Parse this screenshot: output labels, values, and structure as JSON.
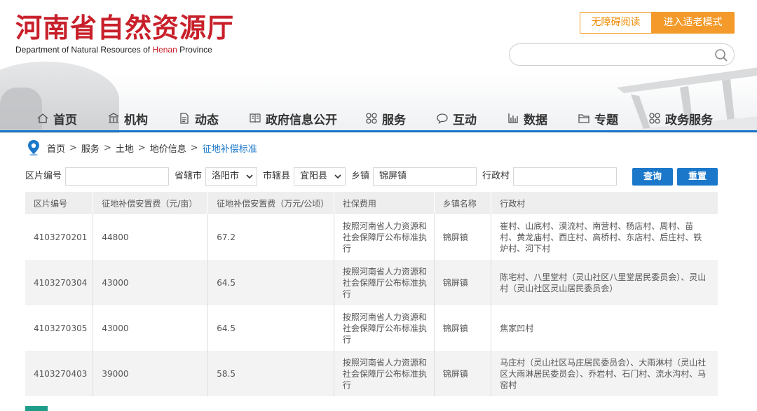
{
  "header": {
    "logo_cn": "河南省自然资源厅",
    "logo_en_prefix": "Department of Natural Resources of ",
    "logo_en_henan": "Henan",
    "logo_en_suffix": " Province",
    "accessibility_label": "无障碍阅读",
    "elder_mode_label": "进入适老模式",
    "search_placeholder": ""
  },
  "nav": {
    "items": [
      {
        "label": "首页",
        "icon": "home-icon"
      },
      {
        "label": "机构",
        "icon": "building-icon"
      },
      {
        "label": "动态",
        "icon": "document-icon"
      },
      {
        "label": "政府信息公开",
        "icon": "book-icon"
      },
      {
        "label": "服务",
        "icon": "grid-icon"
      },
      {
        "label": "互动",
        "icon": "chat-icon"
      },
      {
        "label": "数据",
        "icon": "bar-chart-icon"
      },
      {
        "label": "专题",
        "icon": "folder-icon"
      },
      {
        "label": "政务服务",
        "icon": "grid-icon"
      }
    ]
  },
  "breadcrumb": {
    "items": [
      "首页",
      "服务",
      "土地",
      "地价信息"
    ],
    "current": "征地补偿标准",
    "separators": [
      ">",
      ">",
      ">",
      ">"
    ]
  },
  "filters": {
    "block_no_label": "区片编号",
    "block_no_value": "",
    "province_city_label": "省辖市",
    "province_city_value": "洛阳市",
    "county_label": "市辖县",
    "county_value": "宜阳县",
    "township_label": "乡镇",
    "township_value": "锦屏镇",
    "village_label": "行政村",
    "village_value": "",
    "query_label": "查询",
    "reset_label": "重置"
  },
  "table": {
    "headers": [
      "区片编号",
      "征地补偿安置费（元/亩）",
      "征地补偿安置费（万元/公顷）",
      "社保费用",
      "乡镇名称",
      "行政村"
    ],
    "rows": [
      {
        "id": "4103270201",
        "yuan_mu": "44800",
        "wan_ha": "67.2",
        "social": "按照河南省人力资源和社会保障厅公布标准执行",
        "town": "锦屏镇",
        "villages": "崔村、山底村、漠流村、南营村、杨店村、周村、苗村、黄龙庙村、西庄村、高桥村、东店村、后庄村、铁炉村、河下村"
      },
      {
        "id": "4103270304",
        "yuan_mu": "43000",
        "wan_ha": "64.5",
        "social": "按照河南省人力资源和社会保障厅公布标准执行",
        "town": "锦屏镇",
        "villages": "陈宅村、八里堂村（灵山社区八里堂居民委员会）、灵山村（灵山社区灵山居民委员会）"
      },
      {
        "id": "4103270305",
        "yuan_mu": "43000",
        "wan_ha": "64.5",
        "social": "按照河南省人力资源和社会保障厅公布标准执行",
        "town": "锦屏镇",
        "villages": "焦家凹村"
      },
      {
        "id": "4103270403",
        "yuan_mu": "39000",
        "wan_ha": "58.5",
        "social": "按照河南省人力资源和社会保障厅公布标准执行",
        "town": "锦屏镇",
        "villages": "马庄村（灵山社区马庄居民委员会）、大雨淋村（灵山社区大雨淋居民委员会）、乔岩村、石门村、流水沟村、马窑村"
      }
    ]
  },
  "colors": {
    "brand_red": "#c8202a",
    "accent_blue": "#1a77c9",
    "orange": "#f39a2a",
    "teal": "#1e9e8a"
  }
}
